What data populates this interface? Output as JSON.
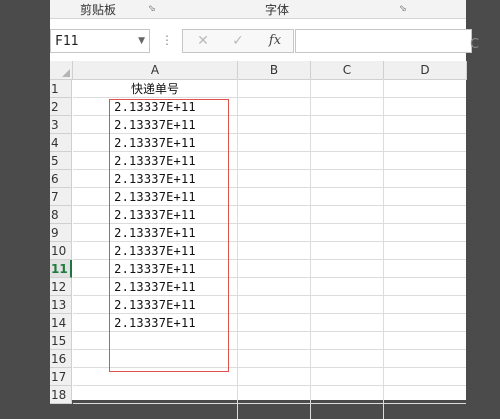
{
  "ribbon": {
    "clipboard_label": "剪贴板",
    "font_label": "字体",
    "launcher_icon": "dialog-launcher-icon"
  },
  "formula_bar": {
    "name_box": "F11",
    "cancel_symbol": "✕",
    "enter_symbol": "✓",
    "function_symbol": "fx",
    "formula_value": "",
    "trailing_letter": "C"
  },
  "sheet": {
    "columns": [
      "A",
      "B",
      "C",
      "D"
    ],
    "rows": [
      "1",
      "2",
      "3",
      "4",
      "5",
      "6",
      "7",
      "8",
      "9",
      "10",
      "11",
      "12",
      "13",
      "14",
      "15",
      "16",
      "17",
      "18"
    ],
    "active_row": "11",
    "cells": [
      "快递单号",
      "2.13337E+11",
      "2.13337E+11",
      "2.13337E+11",
      "2.13337E+11",
      "2.13337E+11",
      "2.13337E+11",
      "2.13337E+11",
      "2.13337E+11",
      "2.13337E+11",
      "2.13337E+11",
      "2.13337E+11",
      "2.13337E+11",
      "2.13337E+11",
      "",
      "",
      "",
      ""
    ]
  },
  "colors": {
    "highlight_border": "#e0514c",
    "active_row_text": "#1f7a3e"
  }
}
